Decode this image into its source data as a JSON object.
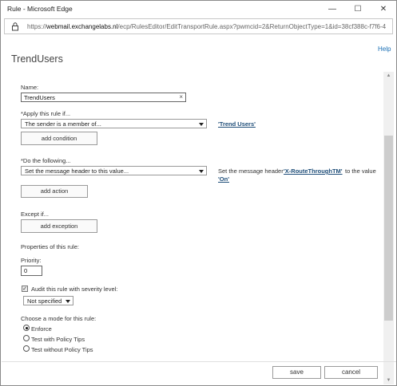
{
  "window": {
    "title": "Rule - Microsoft Edge",
    "minimize_glyph": "—",
    "maximize_glyph": "☐",
    "close_glyph": "✕"
  },
  "address": {
    "scheme": "https://",
    "host": "webmail.exchangelabs.nl",
    "path": "/ecp/RulesEditor/EditTransportRule.aspx?pwmcid=2&ReturnObjectType=1&id=38cf388c-f7f6-4"
  },
  "page": {
    "title": "TrendUsers",
    "help": "Help"
  },
  "name_field": {
    "label": "Name:",
    "value": "TrendUsers",
    "clear_glyph": "×"
  },
  "apply_if": {
    "label": "*Apply this rule if...",
    "selected": "The sender is a member of...",
    "value_link": "'Trend Users'",
    "add_button": "add condition"
  },
  "do_following": {
    "label": "*Do the following...",
    "selected": "Set the message header to this value...",
    "desc_prefix": "Set the message header",
    "header_link": "'X-RouteThroughTM'",
    "desc_middle": "to the value",
    "value_link": "'On'",
    "add_button": "add action"
  },
  "except_if": {
    "label": "Except if...",
    "add_button": "add exception"
  },
  "properties": {
    "label": "Properties of this rule:",
    "priority_label": "Priority:",
    "priority_value": "0",
    "audit_checked": true,
    "audit_check_glyph": "✓",
    "audit_label": "Audit this rule with severity level:",
    "severity_selected": "Not specified"
  },
  "mode": {
    "label": "Choose a mode for this rule:",
    "options": [
      {
        "label": "Enforce",
        "selected": true
      },
      {
        "label": "Test with Policy Tips",
        "selected": false
      },
      {
        "label": "Test without Policy Tips",
        "selected": false
      }
    ]
  },
  "footer": {
    "save": "save",
    "cancel": "cancel"
  },
  "scrollbar": {
    "up_glyph": "▲",
    "down_glyph": "▼"
  }
}
